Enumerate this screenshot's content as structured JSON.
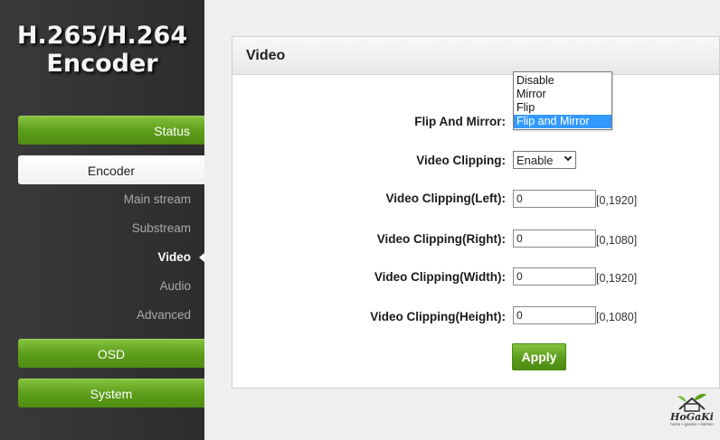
{
  "brand": {
    "line1": "H.265/H.264",
    "line2": "Encoder"
  },
  "nav": {
    "status": "Status",
    "encoder": "Encoder",
    "sub": {
      "main_stream": "Main stream",
      "substream": "Substream",
      "video": "Video",
      "audio": "Audio",
      "advanced": "Advanced"
    },
    "osd": "OSD",
    "system": "System"
  },
  "panel": {
    "title": "Video",
    "flip_mirror": {
      "label": "Flip And Mirror:",
      "options": [
        "Disable",
        "Mirror",
        "Flip",
        "Flip and Mirror"
      ],
      "selected": "Flip and Mirror"
    },
    "clipping": {
      "label": "Video Clipping:",
      "value": "Enable"
    },
    "clip_left": {
      "label": "Video Clipping(Left):",
      "value": "0",
      "range": "[0,1920]"
    },
    "clip_right": {
      "label": "Video Clipping(Right):",
      "value": "0",
      "range": "[0,1080]"
    },
    "clip_width": {
      "label": "Video Clipping(Width):",
      "value": "0",
      "range": "[0,1920]"
    },
    "clip_height": {
      "label": "Video Clipping(Height):",
      "value": "0",
      "range": "[0,1080]"
    },
    "apply_label": "Apply"
  },
  "watermark": {
    "name": "HoGaKi",
    "tagline": "home • garden • kitchen"
  },
  "colors": {
    "accent_green": "#5d9e1b",
    "sidebar_bg": "#333333",
    "selection_blue": "#3399ff"
  }
}
